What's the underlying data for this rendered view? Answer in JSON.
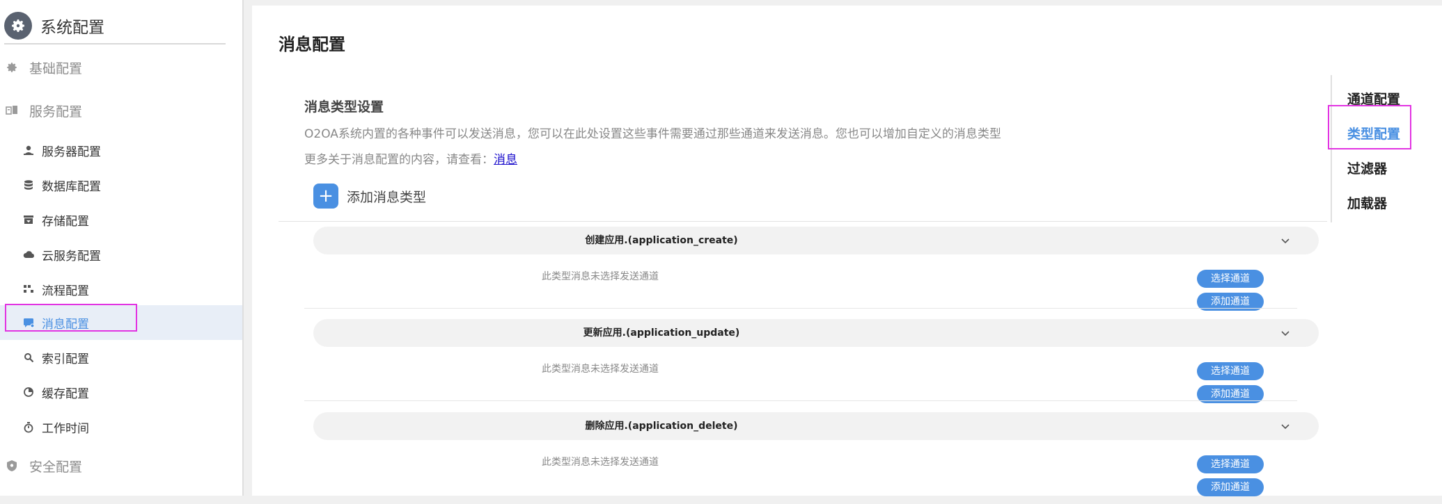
{
  "sidebar": {
    "title": "系统配置",
    "items": [
      {
        "label": "基础配置",
        "icon": "gear-icon",
        "type": "group"
      },
      {
        "label": "服务配置",
        "icon": "services-icon",
        "type": "group"
      },
      {
        "label": "服务器配置",
        "icon": "server-icon",
        "type": "sub"
      },
      {
        "label": "数据库配置",
        "icon": "database-icon",
        "type": "sub"
      },
      {
        "label": "存储配置",
        "icon": "storage-icon",
        "type": "sub"
      },
      {
        "label": "云服务配置",
        "icon": "cloud-icon",
        "type": "sub"
      },
      {
        "label": "流程配置",
        "icon": "process-icon",
        "type": "sub"
      },
      {
        "label": "消息配置",
        "icon": "message-icon",
        "type": "sub",
        "active": true
      },
      {
        "label": "索引配置",
        "icon": "search-icon",
        "type": "sub"
      },
      {
        "label": "缓存配置",
        "icon": "pie-icon",
        "type": "sub"
      },
      {
        "label": "工作时间",
        "icon": "stopwatch-icon",
        "type": "sub"
      },
      {
        "label": "安全配置",
        "icon": "shield-icon",
        "type": "group"
      }
    ]
  },
  "main": {
    "title": "消息配置",
    "section_title": "消息类型设置",
    "description": "O2OA系统内置的各种事件可以发送消息，您可以在此处设置这些事件需要通过那些通道来发送消息。您也可以增加自定义的消息类型",
    "more_prefix": "更多关于消息配置的内容，请查看：",
    "more_link": "消息",
    "add_type_label": "添加消息类型",
    "add_icon": "+",
    "message_types": [
      {
        "name": "创建应用.(application_create)",
        "empty_text": "此类型消息未选择发送通道",
        "select_label": "选择通道",
        "add_label": "添加通道"
      },
      {
        "name": "更新应用.(application_update)",
        "empty_text": "此类型消息未选择发送通道",
        "select_label": "选择通道",
        "add_label": "添加通道"
      },
      {
        "name": "删除应用.(application_delete)",
        "empty_text": "此类型消息未选择发送通道",
        "select_label": "选择通道",
        "add_label": "添加通道"
      }
    ]
  },
  "right_nav": {
    "items": [
      {
        "label": "通道配置"
      },
      {
        "label": "类型配置",
        "active": true
      },
      {
        "label": "过滤器"
      },
      {
        "label": "加载器"
      }
    ]
  },
  "colors": {
    "accent": "#4a90e2",
    "highlight": "#e233e2",
    "active_bg": "#e8eef7"
  }
}
